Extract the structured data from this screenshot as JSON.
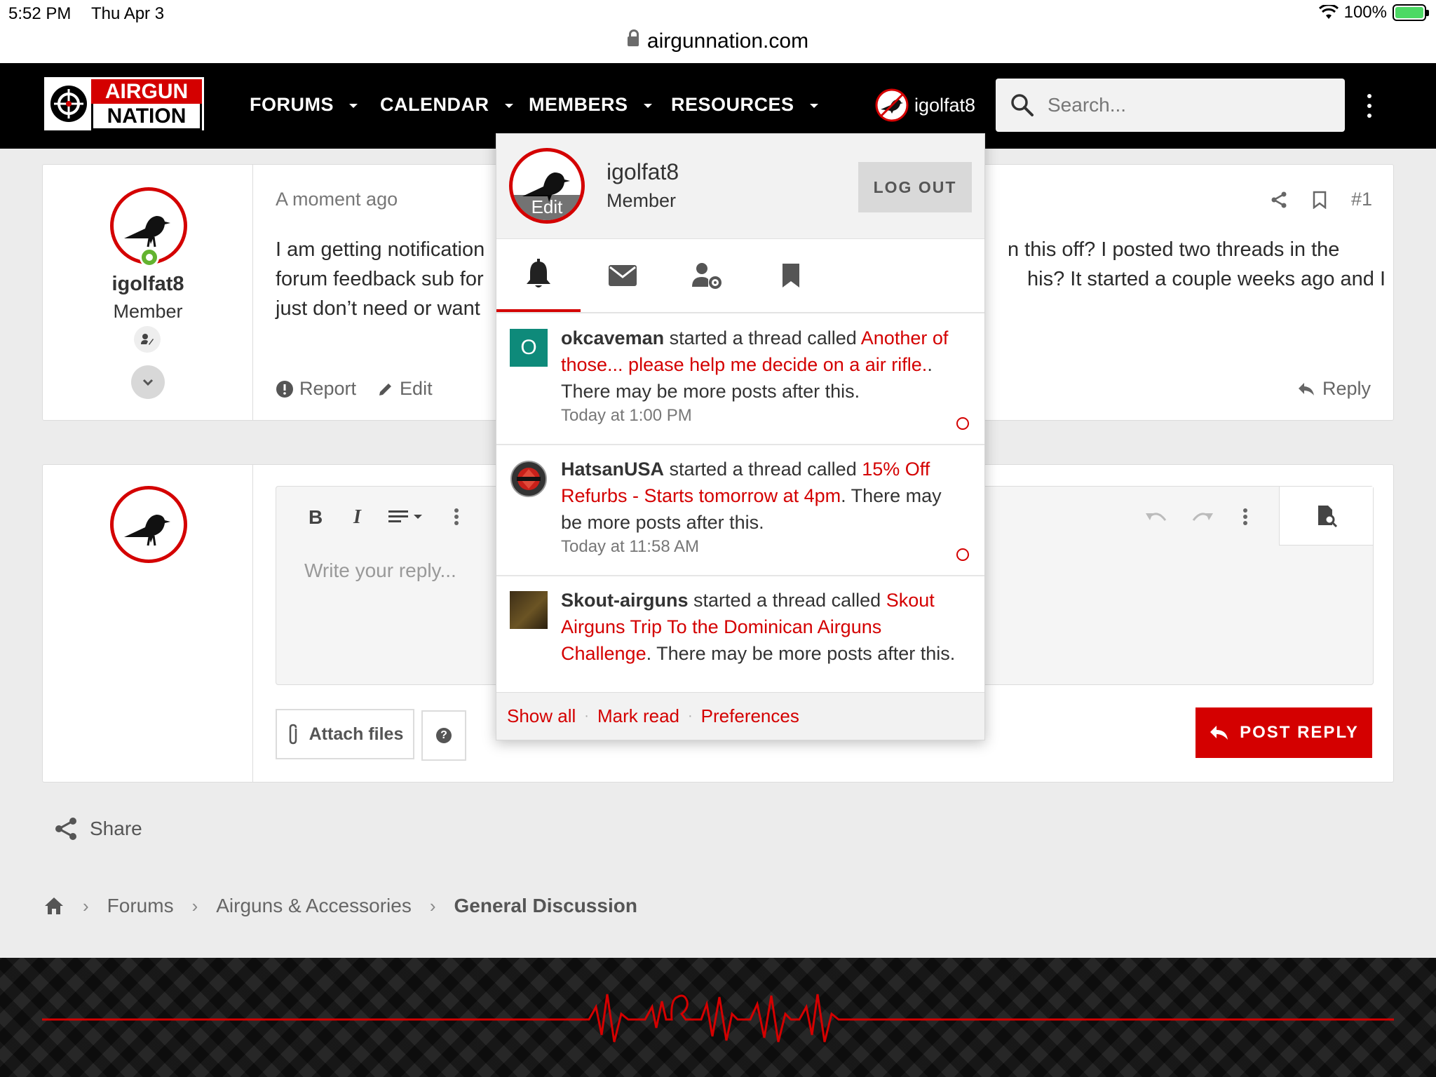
{
  "status_bar": {
    "time": "5:52 PM",
    "date": "Thu Apr 3",
    "battery": "100%"
  },
  "browser": {
    "url": "airgunnation.com"
  },
  "site": {
    "logo_line1": "AIRGUN",
    "logo_line2": "NATION",
    "nav": [
      {
        "label": "FORUMS"
      },
      {
        "label": "CALENDAR"
      },
      {
        "label": "MEMBERS"
      },
      {
        "label": "RESOURCES"
      }
    ],
    "username": "igolfat8",
    "search_placeholder": "Search..."
  },
  "post": {
    "time": "A moment ago",
    "number": "#1",
    "author": "igolfat8",
    "author_title": "Member",
    "body_lines_left": [
      "I am getting notification",
      "forum feedback sub for",
      "just don’t need or want"
    ],
    "body_lines_right": [
      "n this off? I posted two threads in the",
      "his? It started a couple weeks ago and I"
    ],
    "report_label": "Report",
    "edit_label": "Edit",
    "reply_label": "Reply"
  },
  "reply_box": {
    "placeholder": "Write your reply...",
    "attach_label": "Attach files",
    "help_label": "?",
    "post_reply_label": "POST REPLY"
  },
  "share_label": "Share",
  "breadcrumb": [
    "Forums",
    "Airguns & Accessories",
    "General Discussion"
  ],
  "popup": {
    "name": "igolfat8",
    "title": "Member",
    "edit_label": "Edit",
    "logout_label": "LOG OUT",
    "notifications": [
      {
        "user": "okcaveman",
        "action": " started a thread called ",
        "thread": "Another of those... please help me decide on a air rifle.",
        "suffix": ". There may be more posts after this.",
        "time": "Today at 1:00 PM",
        "avatar_letter": "O",
        "avatar_color": "#0e8a7a"
      },
      {
        "user": "HatsanUSA",
        "action": " started a thread called ",
        "thread": "15% Off Refurbs - Starts tomorrow at 4pm",
        "suffix": ". There may be more posts after this.",
        "time": "Today at 11:58 AM"
      },
      {
        "user": "Skout-airguns",
        "action": " started a thread called ",
        "thread": "Skout Airguns Trip To the Dominican Airguns Challenge",
        "suffix": ". There may be more posts after this."
      }
    ],
    "footer_links": [
      "Show all",
      "Mark read",
      "Preferences"
    ]
  },
  "colors": {
    "brand_red": "#d40000",
    "nav_bg": "#000000",
    "online_green": "#63b32f"
  }
}
